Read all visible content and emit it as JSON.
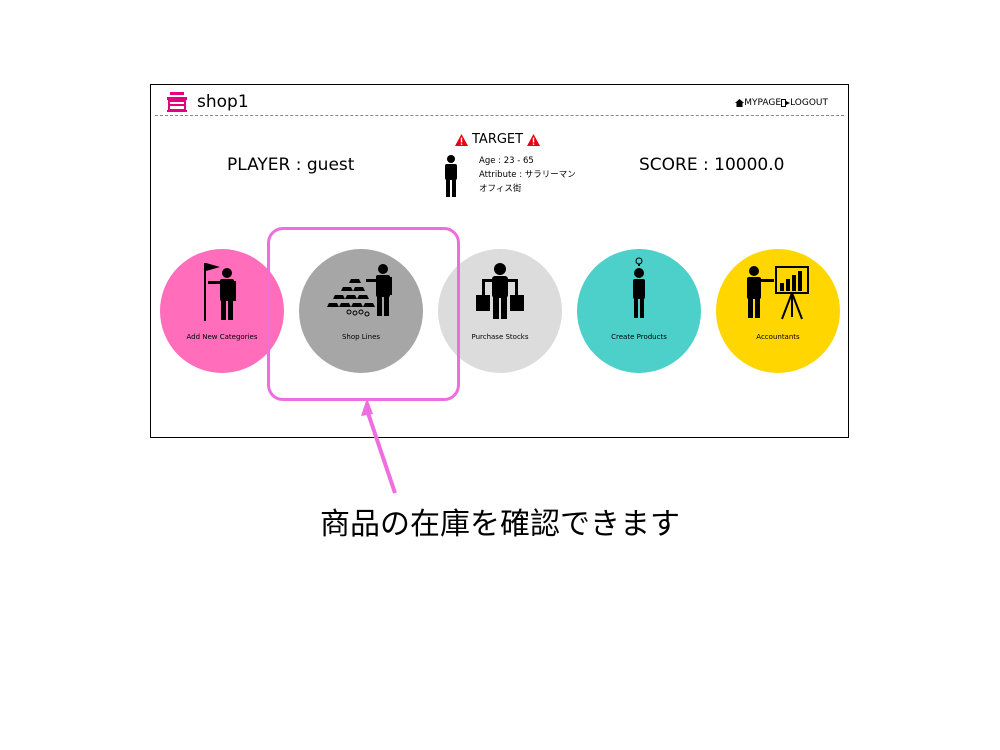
{
  "header": {
    "title": "shop1",
    "mypage": "MYPAGE",
    "logout": "LOGOUT"
  },
  "player": {
    "text": "PLAYER : guest"
  },
  "score": {
    "text": "SCORE : 10000.0"
  },
  "target": {
    "heading": "TARGET",
    "age": "Age : 23 - 65",
    "attribute": "Attribute : サラリーマン",
    "location": "オフィス街"
  },
  "menu": [
    {
      "label": "Add New Categories",
      "color": "#ff6dbb",
      "icon": "flag-businessman-icon"
    },
    {
      "label": "Shop Lines",
      "color": "#a6a6a6",
      "icon": "gold-stock-businessman-icon"
    },
    {
      "label": "Purchase Stocks",
      "color": "#dcdcdc",
      "icon": "shopping-bags-icon"
    },
    {
      "label": "Create Products",
      "color": "#4dd0c9",
      "icon": "idea-person-icon"
    },
    {
      "label": "Accountants",
      "color": "#ffd600",
      "icon": "presentation-board-icon"
    }
  ],
  "colors": {
    "highlight": "#ee6ee0",
    "warning": "#e60012",
    "shop_icon": "#e4007f"
  },
  "caption": "商品の在庫を確認できます"
}
